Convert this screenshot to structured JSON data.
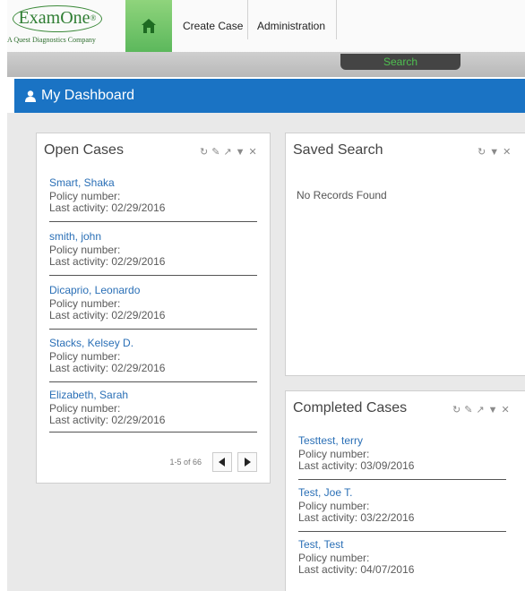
{
  "header": {
    "logo_text": "ExamOne",
    "logo_trademark": "®",
    "logo_tagline": "A Quest Diagnostics Company",
    "nav": {
      "create_case": "Create Case",
      "administration": "Administration"
    },
    "search_tab": "Search"
  },
  "dashboard": {
    "title": "My Dashboard"
  },
  "open_cases": {
    "title": "Open Cases",
    "items": [
      {
        "name": "Smart, Shaka",
        "policy": "Policy number:",
        "activity": "Last activity: 02/29/2016"
      },
      {
        "name": "smith, john",
        "policy": "Policy number:",
        "activity": "Last activity: 02/29/2016"
      },
      {
        "name": "Dicaprio, Leonardo",
        "policy": "Policy number:",
        "activity": "Last activity: 02/29/2016"
      },
      {
        "name": "Stacks, Kelsey D.",
        "policy": "Policy number:",
        "activity": "Last activity: 02/29/2016"
      },
      {
        "name": "Elizabeth, Sarah",
        "policy": "Policy number:",
        "activity": "Last activity: 02/29/2016"
      }
    ],
    "pager_text": "1-5 of 66"
  },
  "saved_search": {
    "title": "Saved Search",
    "empty_text": "No Records Found"
  },
  "completed_cases": {
    "title": "Completed Cases",
    "items": [
      {
        "name": "Testtest, terry",
        "policy": "Policy number:",
        "activity": "Last activity: 03/09/2016"
      },
      {
        "name": "Test, Joe T.",
        "policy": "Policy number:",
        "activity": "Last activity: 03/22/2016"
      },
      {
        "name": "Test, Test",
        "policy": "Policy number:",
        "activity": "Last activity: 04/07/2016"
      }
    ]
  },
  "colors": {
    "accent_blue": "#1a73c4",
    "home_green": "#5cb85c",
    "link_blue": "#2a6fb6"
  }
}
